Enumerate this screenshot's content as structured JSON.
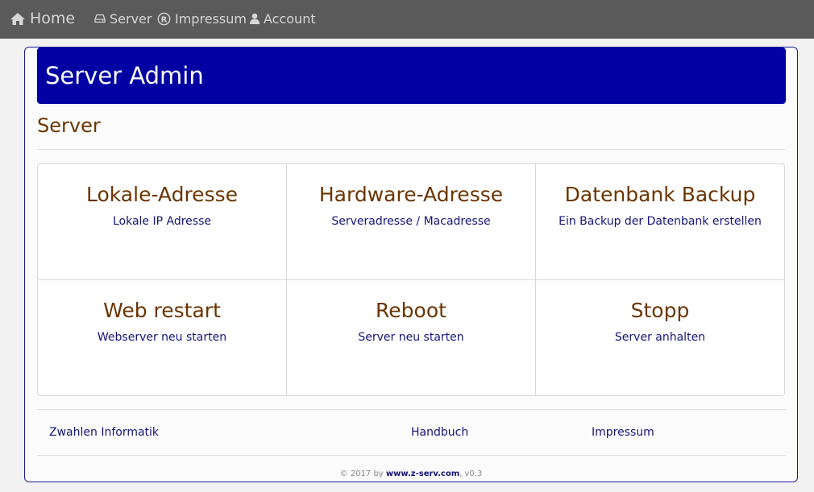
{
  "navbar": {
    "brand": "Home",
    "items": [
      {
        "label": "Server",
        "icon": "hdd-icon"
      },
      {
        "label": "Impressum",
        "icon": "registered-icon"
      },
      {
        "label": "Account",
        "icon": "user-icon"
      }
    ]
  },
  "header": {
    "title": "Server Admin"
  },
  "section": {
    "title": "Server"
  },
  "tiles": [
    {
      "title": "Lokale-Adresse",
      "subtitle": "Lokale IP Adresse"
    },
    {
      "title": "Hardware-Adresse",
      "subtitle": "Serveradresse / Macadresse"
    },
    {
      "title": "Datenbank Backup",
      "subtitle": "Ein Backup der Datenbank erstellen"
    },
    {
      "title": "Web restart",
      "subtitle": "Webserver neu starten"
    },
    {
      "title": "Reboot",
      "subtitle": "Server neu starten"
    },
    {
      "title": "Stopp",
      "subtitle": "Server anhalten"
    }
  ],
  "footer": {
    "links": [
      "Zwahlen Informatik",
      "Handbuch",
      "Impressum"
    ],
    "copyright_prefix": "© 2017 by",
    "copyright_site": "www.z-serv.com",
    "copyright_version": ", v0.3"
  },
  "colors": {
    "navbar_bg": "#5a5a5a",
    "header_bg": "#0000a3",
    "title_brown": "#6b3500",
    "link_navy": "#14147a"
  }
}
